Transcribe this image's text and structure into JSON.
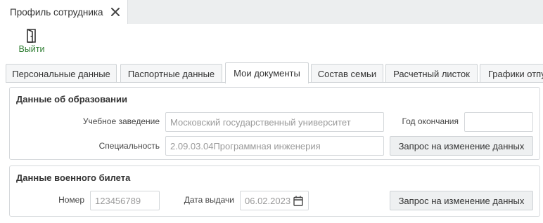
{
  "document_tab": {
    "title": "Профиль сотрудника"
  },
  "toolbar": {
    "exit_label": "Выйти"
  },
  "tabs": [
    {
      "label": "Персональные данные",
      "active": false
    },
    {
      "label": "Паспортные данные",
      "active": false
    },
    {
      "label": "Мои документы",
      "active": true
    },
    {
      "label": "Состав семьи",
      "active": false
    },
    {
      "label": "Расчетный листок",
      "active": false
    },
    {
      "label": "Графики отпу",
      "active": false
    }
  ],
  "education": {
    "title": "Данные об образовании",
    "institution_label": "Учебное заведение",
    "institution_value": "Московский государственный университет",
    "graduation_year_label": "Год окончания",
    "graduation_year_value": "",
    "specialty_label": "Специальность",
    "specialty_value": "2.09.03.04Программная инженерия",
    "request_button": "Запрос на изменение данных"
  },
  "military": {
    "title": "Данные военного билета",
    "number_label": "Номер",
    "number_value": "123456789",
    "issue_date_label": "Дата выдачи",
    "issue_date_value": "06.02.2023",
    "request_button": "Запрос на изменение данных"
  },
  "colors": {
    "accent_green": "#2e7d32",
    "border": "#d6d9dc",
    "tab_bg": "#f5f6f7"
  }
}
